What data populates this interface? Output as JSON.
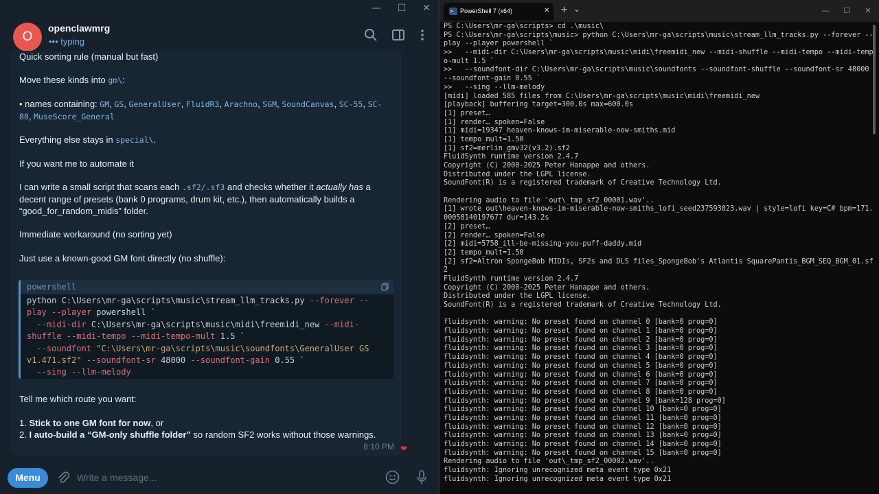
{
  "telegram": {
    "window_controls": {
      "minimize": "—",
      "maximize": "☐",
      "close": "✕"
    },
    "header": {
      "avatar_letter": "O",
      "avatar_color": "#e8584f",
      "chat_name": "openclawmrg",
      "status": "••• typing",
      "icons": [
        "search-icon",
        "sidebar-toggle-icon",
        "more-vertical-icon"
      ]
    },
    "message": {
      "p1": "Quick sorting rule (manual but fast)",
      "p2_prefix": "Move these kinds into ",
      "p2_code": "gm\\",
      "p2_suffix": ":",
      "p3_prefix": "• names containing: ",
      "p3_names": [
        "GM",
        "GS",
        "GeneralUser",
        "FluidR3",
        "Arachno",
        "SGM",
        "SoundCanvas",
        "SC-55",
        "SC-88",
        "MuseScore_General"
      ],
      "p4_prefix": "Everything else stays in ",
      "p4_code": "special\\",
      "p4_suffix": ".",
      "p5": "If you want me to automate it",
      "p6_a": "I can write a small script that scans each ",
      "p6_code": ".sf2/.sf3",
      "p6_b": " and checks whether it ",
      "p6_em": "actually has",
      "p6_c": " a decent range of presets (bank 0 programs, drum kit, etc.), then automatically builds a “good_for_random_midis” folder.",
      "p7": "Immediate workaround (no sorting yet)",
      "p8": "Just use a known-good GM font directly (no shuffle):",
      "code_lang": "powershell",
      "code_l1a": "python C:\\Users\\mr-ga\\scripts\\music\\stream_llm_tracks.py ",
      "code_l1b": "--forever --",
      "code_l2a": "play ",
      "code_l2b": "--player",
      "code_l2c": " powershell `",
      "code_l3a": "  --midi-dir",
      "code_l3b": " C:\\Users\\mr-ga\\scripts\\music\\midi\\freemidi_new ",
      "code_l3c": "--midi-",
      "code_l4a": "shuffle --midi-tempo --midi-tempo-mult",
      "code_l4b": " 1.5 `",
      "code_l5a": "  --soundfont",
      "code_l5b": " \"C:\\Users\\mr-ga\\scripts\\music\\soundfonts\\GeneralUser GS",
      "code_l6a": "v1.471.sf2\"",
      "code_l6b": " --soundfont-sr",
      "code_l6c": " 48000 ",
      "code_l6d": "--soundfont-gain",
      "code_l6e": " 0.55 `",
      "code_l7": "  --sing --llm-melody",
      "p9": "Tell me which route you want:",
      "opt1_num": "1. ",
      "opt1_bold": "Stick to one GM font for now",
      "opt1_rest": ", or",
      "opt2_num": "2. ",
      "opt2_bold": "I auto-build a “GM-only shuffle folder”",
      "opt2_rest": " so random SF2 works without those warnings.",
      "time": "8:10 PM",
      "reaction": "❤"
    },
    "footer": {
      "menu_label": "Menu",
      "input_placeholder": "Write a message..."
    }
  },
  "terminal": {
    "tab_title": "PowerShell 7 (x64)",
    "tab_icon": ">_",
    "new_tab": "+",
    "dropdown": "⌄",
    "window_controls": {
      "minimize": "—",
      "maximize": "☐",
      "close": "✕"
    },
    "lines": [
      "PS C:\\Users\\mr-ga\\scripts> cd .\\music\\",
      "PS C:\\Users\\mr-ga\\scripts\\music> python C:\\Users\\mr-ga\\scripts\\music\\stream_llm_tracks.py --forever --",
      "play --player powershell `",
      ">>   --midi-dir C:\\Users\\mr-ga\\scripts\\music\\midi\\freemidi_new --midi-shuffle --midi-tempo --midi-temp",
      "o-mult 1.5 `",
      ">>   --soundfont-dir C:\\Users\\mr-ga\\scripts\\music\\soundfonts --soundfont-shuffle --soundfont-sr 48000",
      "--soundfont-gain 0.55 `",
      ">>   --sing --llm-melody",
      "[midi] loaded 585 files from C:\\Users\\mr-ga\\scripts\\music\\midi\\freemidi_new",
      "[playback] buffering target=300.0s max=600.0s",
      "[1] preset…",
      "[1] render… spoken=False",
      "[1] midi=19347_heaven-knows-im-miserable-now-smiths.mid",
      "[1] tempo_mult=1.50",
      "[1] sf2=merlin_gmv32(v3.2).sf2",
      "FluidSynth runtime version 2.4.7",
      "Copyright (C) 2000-2025 Peter Hanappe and others.",
      "Distributed under the LGPL license.",
      "SoundFont(R) is a registered trademark of Creative Technology Ltd.",
      "",
      "Rendering audio to file 'out\\_tmp_sf2_00001.wav'..",
      "[1] wrote out\\heaven-knows-im-miserable-now-smiths_lofi_seed237593023.wav | style=lofi key=C# bpm=171.",
      "00058140197677 dur=143.2s",
      "[2] preset…",
      "[2] render… spoken=False",
      "[2] midi=5758_ill-be-missing-you-puff-daddy.mid",
      "[2] tempo_mult=1.50",
      "[2] sf2=Altron SpongeBob MIDIs, SF2s and DLS files_SpongeBob's Atlantis SquarePantis_BGM_SEQ_BGM_01.sf",
      "2",
      "FluidSynth runtime version 2.4.7",
      "Copyright (C) 2000-2025 Peter Hanappe and others.",
      "Distributed under the LGPL license.",
      "SoundFont(R) is a registered trademark of Creative Technology Ltd.",
      "",
      "fluidsynth: warning: No preset found on channel 0 [bank=0 prog=0]",
      "fluidsynth: warning: No preset found on channel 1 [bank=0 prog=0]",
      "fluidsynth: warning: No preset found on channel 2 [bank=0 prog=0]",
      "fluidsynth: warning: No preset found on channel 3 [bank=0 prog=0]",
      "fluidsynth: warning: No preset found on channel 4 [bank=0 prog=0]",
      "fluidsynth: warning: No preset found on channel 5 [bank=0 prog=0]",
      "fluidsynth: warning: No preset found on channel 6 [bank=0 prog=0]",
      "fluidsynth: warning: No preset found on channel 7 [bank=0 prog=0]",
      "fluidsynth: warning: No preset found on channel 8 [bank=0 prog=0]",
      "fluidsynth: warning: No preset found on channel 9 [bank=128 prog=0]",
      "fluidsynth: warning: No preset found on channel 10 [bank=0 prog=0]",
      "fluidsynth: warning: No preset found on channel 11 [bank=0 prog=0]",
      "fluidsynth: warning: No preset found on channel 12 [bank=0 prog=0]",
      "fluidsynth: warning: No preset found on channel 13 [bank=0 prog=0]",
      "fluidsynth: warning: No preset found on channel 14 [bank=0 prog=0]",
      "fluidsynth: warning: No preset found on channel 15 [bank=0 prog=0]",
      "Rendering audio to file 'out\\_tmp_sf2_00002.wav'..",
      "fluidsynth: Ignoring unrecognized meta event type 0x21",
      "fluidsynth: Ignoring unrecognized meta event type 0x21"
    ]
  }
}
